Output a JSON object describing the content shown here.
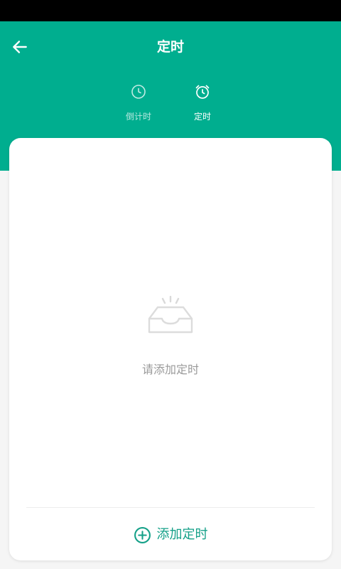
{
  "header": {
    "title": "定时",
    "back_icon": "arrow-left-icon",
    "background_color": "#00ae8f"
  },
  "tabs": [
    {
      "label": "倒计时",
      "icon": "clock-icon",
      "selected": false
    },
    {
      "label": "定时",
      "icon": "alarm-clock-icon",
      "selected": true
    }
  ],
  "empty_state": {
    "icon": "empty-inbox-icon",
    "text": "请添加定时"
  },
  "add_action": {
    "icon": "plus-circle-icon",
    "label": "添加定时",
    "color": "#14a088"
  }
}
